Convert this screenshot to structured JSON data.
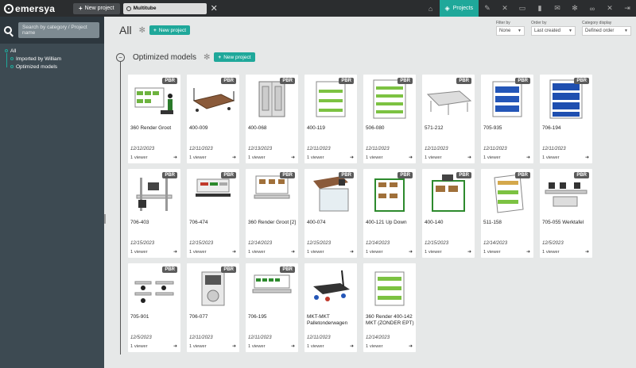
{
  "topbar": {
    "logo_text": "emersya",
    "new_project_label": "New project",
    "search_value": "Multitube",
    "projects_label": "Projects",
    "icons": [
      "home-icon",
      "projects-icon",
      "tools-icon",
      "wrench-icon",
      "basket-icon",
      "chart-icon",
      "mail-icon",
      "settings-icon",
      "link-icon",
      "admin-icon",
      "logout-icon"
    ]
  },
  "sidebar": {
    "search_placeholder": "Search by category / Project name",
    "tree": [
      {
        "label": "All",
        "level": 0
      },
      {
        "label": "Imported by William",
        "level": 1
      },
      {
        "label": "Optimized models",
        "level": 1
      }
    ]
  },
  "main": {
    "title": "All",
    "new_project_label": "New project",
    "filters": [
      {
        "label": "Filter by",
        "value": "None"
      },
      {
        "label": "Order by",
        "value": "Last created"
      },
      {
        "label": "Category display",
        "value": "Defined order"
      }
    ],
    "section": {
      "title": "Optimized models",
      "new_project_label": "New project"
    },
    "cards": [
      {
        "name": "360 Render Groot",
        "date": "12/12/2023",
        "viewers": "1 viewer",
        "badge": "PBR",
        "thumb": "green-cart-person"
      },
      {
        "name": "400-009",
        "date": "12/11/2023",
        "viewers": "1 viewer",
        "badge": "PBR",
        "thumb": "wood-platform"
      },
      {
        "name": "400-068",
        "date": "12/13/2023",
        "viewers": "1 viewer",
        "badge": "PBR",
        "thumb": "grey-cabinet"
      },
      {
        "name": "400-119",
        "date": "12/11/2023",
        "viewers": "1 viewer",
        "badge": "PBR",
        "thumb": "green-rack"
      },
      {
        "name": "506-080",
        "date": "12/11/2023",
        "viewers": "1 viewer",
        "badge": "PBR",
        "thumb": "green-rack-tall"
      },
      {
        "name": "571-212",
        "date": "12/11/2023",
        "viewers": "1 viewer",
        "badge": "PBR",
        "thumb": "roller-conveyor"
      },
      {
        "name": "705-935",
        "date": "12/11/2023",
        "viewers": "1 viewer",
        "badge": "PBR",
        "thumb": "blue-rack"
      },
      {
        "name": "706-194",
        "date": "12/11/2023",
        "viewers": "1 viewer",
        "badge": "PBR",
        "thumb": "blue-rack-tall"
      },
      {
        "name": "706-403",
        "date": "12/15/2023",
        "viewers": "1 viewer",
        "badge": "PBR",
        "thumb": "workbench-screen"
      },
      {
        "name": "706-474",
        "date": "12/15/2023",
        "viewers": "1 viewer",
        "badge": "PBR",
        "thumb": "workbench-shelves"
      },
      {
        "name": "360 Render Groot [2]",
        "date": "12/14/2023",
        "viewers": "1 viewer",
        "badge": "PBR",
        "thumb": "workbench-boxes"
      },
      {
        "name": "400-074",
        "date": "12/15/2023",
        "viewers": "1 viewer",
        "badge": "PBR",
        "thumb": "glass-cabinet"
      },
      {
        "name": "400-121 Up Down",
        "date": "12/14/2023",
        "viewers": "1 viewer",
        "badge": "PBR",
        "thumb": "green-trolley"
      },
      {
        "name": "400-140",
        "date": "12/15/2023",
        "viewers": "1 viewer",
        "badge": "PBR",
        "thumb": "green-trolley-2"
      },
      {
        "name": "511-158",
        "date": "12/14/2023",
        "viewers": "1 viewer",
        "badge": "PBR",
        "thumb": "angled-rack"
      },
      {
        "name": "705-055 Werktafel",
        "date": "12/5/2023",
        "viewers": "1 viewer",
        "badge": "PBR",
        "thumb": "workstation-set"
      },
      {
        "name": "705-901",
        "date": "12/5/2023",
        "viewers": "1 viewer",
        "badge": "PBR",
        "thumb": "office-desks"
      },
      {
        "name": "706-077",
        "date": "12/11/2023",
        "viewers": "1 viewer",
        "badge": "PBR",
        "thumb": "machine-stand"
      },
      {
        "name": "706-195",
        "date": "12/11/2023",
        "viewers": "1 viewer",
        "badge": "PBR",
        "thumb": "bench-bins"
      },
      {
        "name": "MKT-MKT Palletonderwagen",
        "date": "12/11/2023",
        "viewers": "1 viewer",
        "badge": "",
        "thumb": "pallet-wagon"
      },
      {
        "name": "360 Render 400-142 MKT (ZONDER EPT)",
        "date": "12/14/2023",
        "viewers": "1 viewer",
        "badge": "",
        "thumb": "green-cart"
      }
    ]
  },
  "colors": {
    "accent": "#1fa89a",
    "topbar": "#2b2d2f",
    "sidebar": "#3d4a52",
    "background": "#e6e8e8"
  }
}
